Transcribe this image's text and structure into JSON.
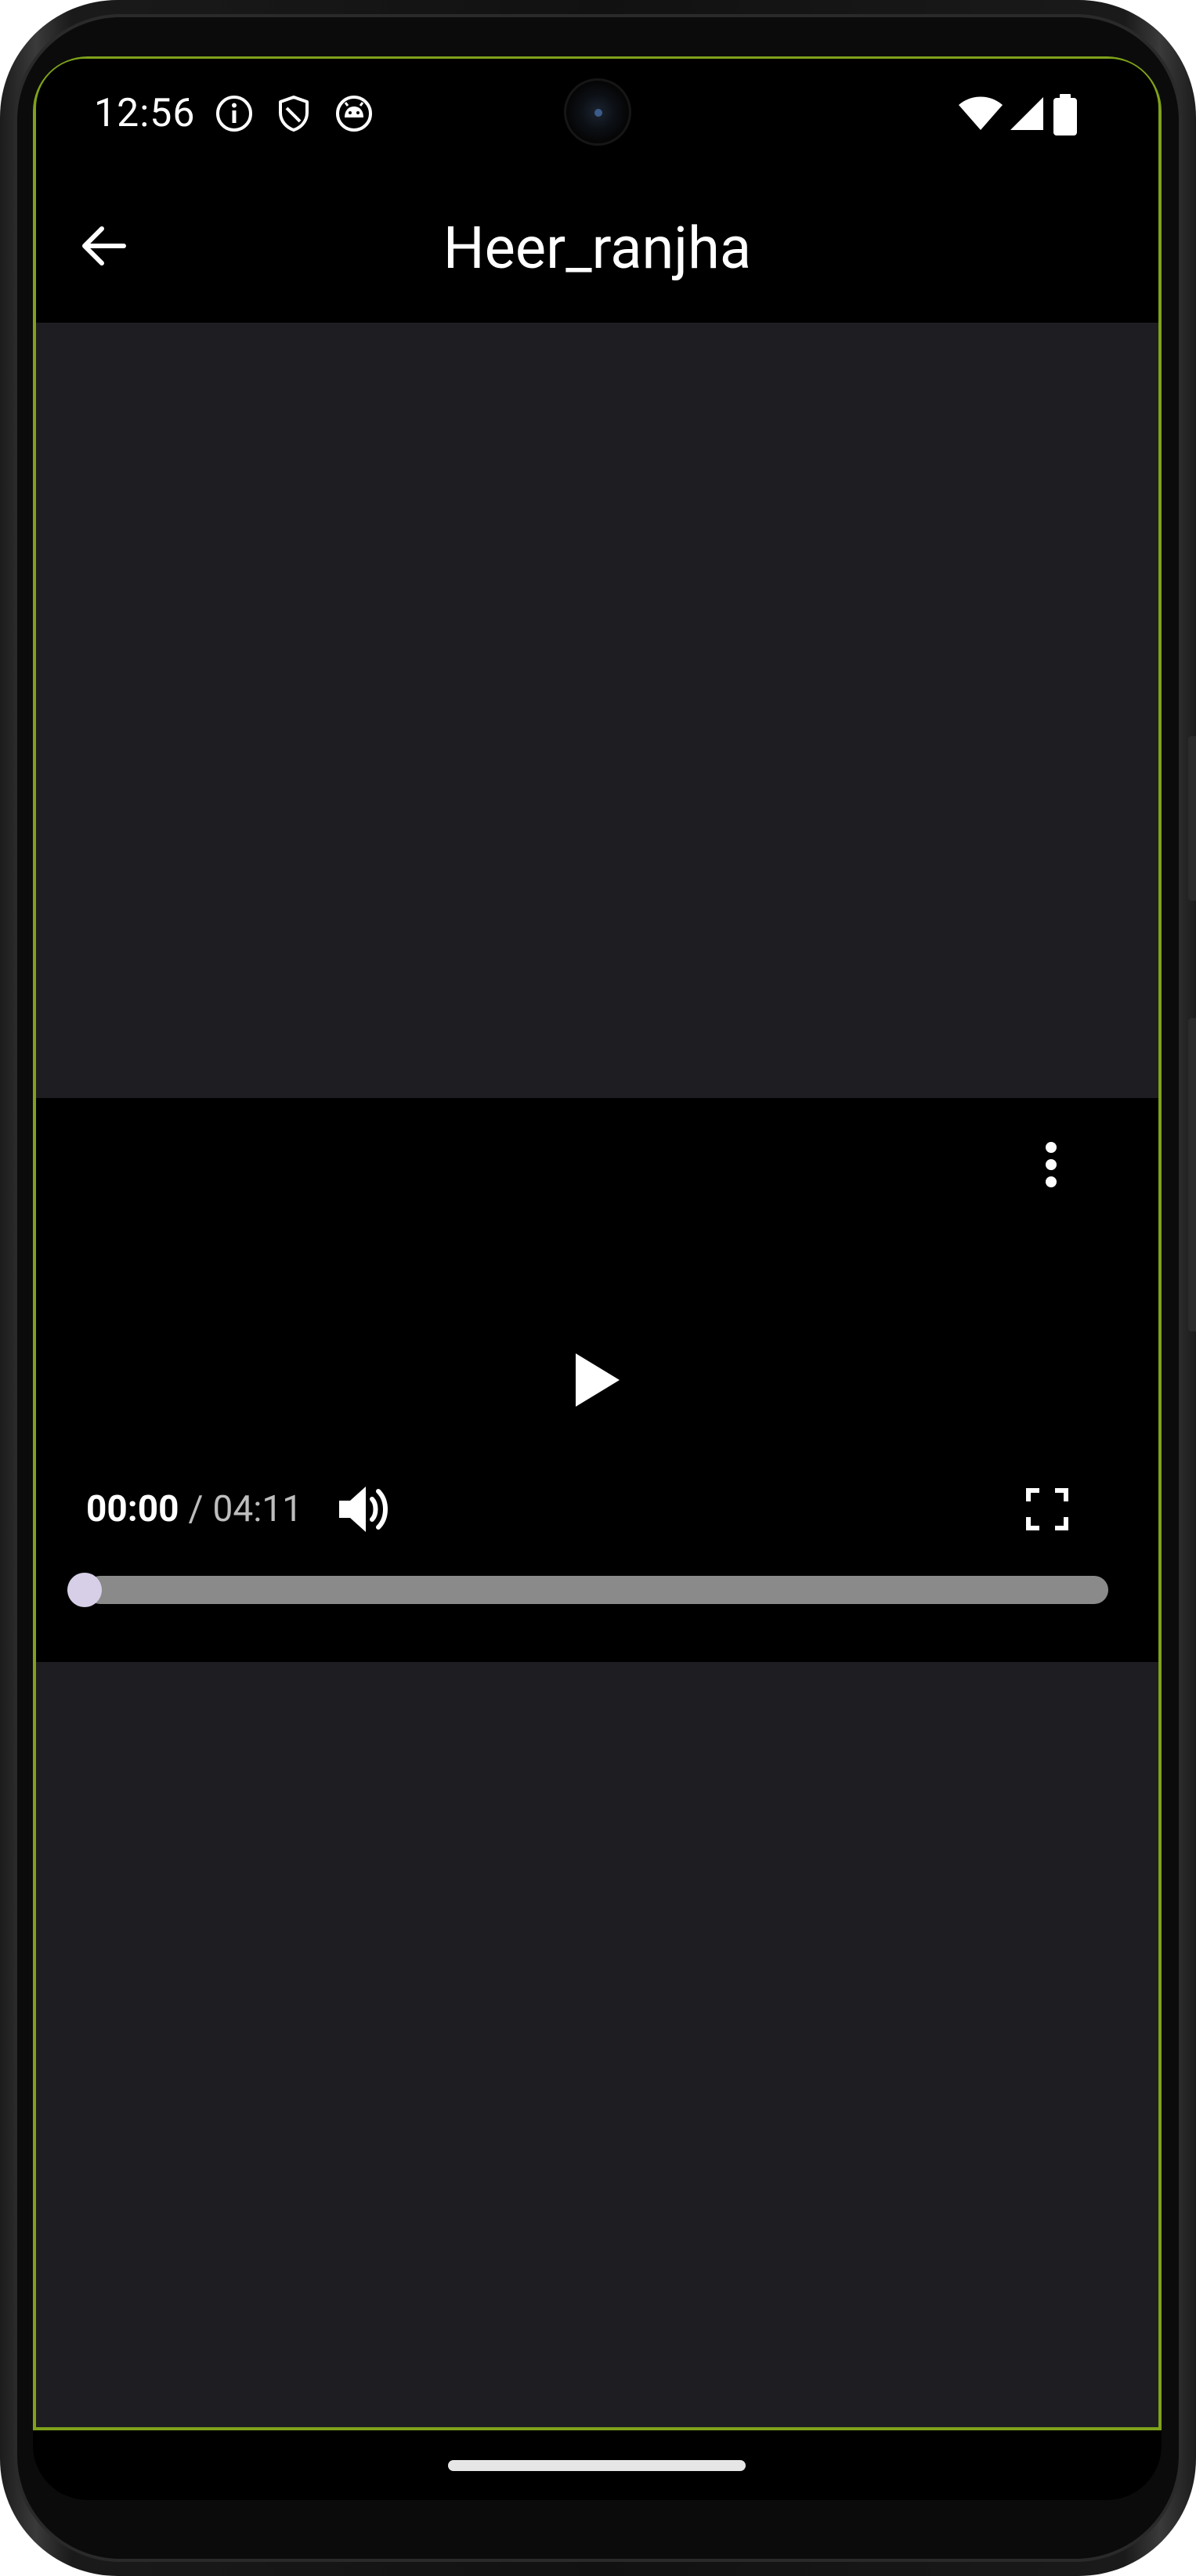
{
  "status_bar": {
    "time": "12:56",
    "icons": [
      "info-icon",
      "shield-icon",
      "android-icon",
      "wifi-icon",
      "signal-icon",
      "battery-icon"
    ]
  },
  "app_bar": {
    "title": "Heer_ranjha",
    "back_icon": "arrow-back-icon"
  },
  "player": {
    "current_time": "00:00",
    "separator": "/",
    "total_time": "04:11",
    "progress": 0.0,
    "icons": {
      "menu": "more-vert-icon",
      "play": "play-icon",
      "volume": "volume-up-icon",
      "fullscreen": "fullscreen-icon"
    }
  },
  "colors": {
    "app_background": "#000000",
    "content_background": "#1e1e22",
    "accent_frame": "#7fa21a",
    "progress_track": "#8a8a8a",
    "progress_thumb": "#d7cfe8",
    "text_primary": "#ffffff",
    "text_secondary": "#bdbdbd"
  }
}
